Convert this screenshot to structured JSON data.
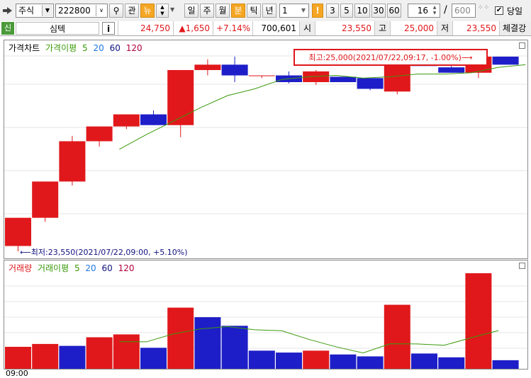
{
  "toolbar": {
    "market": "주식",
    "code": "222800",
    "btn_gwan": "관",
    "btn_new": "뉴",
    "periods": [
      "일",
      "주",
      "월",
      "분",
      "틱",
      "년"
    ],
    "selected_period": "분",
    "interval_value": "1",
    "marker": "!",
    "quick_intervals": [
      "3",
      "5",
      "10",
      "30",
      "60"
    ],
    "count_value": "16",
    "slash": "/",
    "total_value": "600",
    "today_label": "당일"
  },
  "infobar": {
    "tag": "신",
    "name": "심텍",
    "info_icon": "i",
    "price": "24,750",
    "change": "▲1,650",
    "change_pct": "+7.14%",
    "volume": "700,601",
    "open_label": "시",
    "open": "23,550",
    "high_label": "고",
    "high": "25,000",
    "low_label": "저",
    "low": "23,550",
    "trade_label": "체결강"
  },
  "price_panel": {
    "title": "가격차트",
    "ma_label": "가격이평",
    "ma_periods": [
      "5",
      "20",
      "60",
      "120"
    ],
    "high_annotation": "최고:25,000(2021/07/22,09:17, -1.00%)⟶",
    "low_annotation": "⟵최저:23,550(2021/07/22,09:00, +5.10%)"
  },
  "volume_panel": {
    "title": "거래량",
    "ma_label": "거래이평",
    "ma_periods": [
      "5",
      "20",
      "60",
      "120"
    ]
  },
  "x_axis_start": "09:00",
  "colors": {
    "up": "#e0181b",
    "down": "#1e1ec8",
    "ma5": "#3a9a0a",
    "ma20": "#1e78e0",
    "ma60": "#101080",
    "ma120": "#b0003a",
    "annot": "#e0181b"
  },
  "chart_data": [
    {
      "type": "candlestick",
      "ylim": [
        23500,
        25060
      ],
      "candles": [
        {
          "o": 23550,
          "h": 23640,
          "l": 23510,
          "c": 23760
        },
        {
          "o": 23760,
          "h": 23960,
          "l": 23730,
          "c": 24030
        },
        {
          "o": 24030,
          "h": 24370,
          "l": 24000,
          "c": 24330
        },
        {
          "o": 24330,
          "h": 24380,
          "l": 24290,
          "c": 24440
        },
        {
          "o": 24440,
          "h": 24480,
          "l": 24420,
          "c": 24530
        },
        {
          "o": 24530,
          "h": 24560,
          "l": 24490,
          "c": 24450
        },
        {
          "o": 24450,
          "h": 24860,
          "l": 24360,
          "c": 24860
        },
        {
          "o": 24860,
          "h": 24940,
          "l": 24820,
          "c": 24900
        },
        {
          "o": 24900,
          "h": 24960,
          "l": 24770,
          "c": 24820
        },
        {
          "o": 24820,
          "h": 24820,
          "l": 24800,
          "c": 24820
        },
        {
          "o": 24820,
          "h": 24850,
          "l": 24760,
          "c": 24770
        },
        {
          "o": 24770,
          "h": 24860,
          "l": 24750,
          "c": 24850
        },
        {
          "o": 24810,
          "h": 24810,
          "l": 24770,
          "c": 24770
        },
        {
          "o": 24800,
          "h": 24800,
          "l": 24710,
          "c": 24720
        },
        {
          "o": 24700,
          "h": 24940,
          "l": 24680,
          "c": 24930
        },
        {
          "o": 24930,
          "h": 24930,
          "l": 24890,
          "c": 24890
        },
        {
          "o": 24880,
          "h": 24890,
          "l": 24840,
          "c": 24840
        },
        {
          "o": 24840,
          "h": 25000,
          "l": 24800,
          "c": 24960
        },
        {
          "o": 24960,
          "h": 24960,
          "l": 24900,
          "c": 24900
        }
      ],
      "ma5": [
        null,
        null,
        null,
        null,
        24270,
        24380,
        24480,
        24580,
        24670,
        24720,
        24790,
        24810,
        24820,
        24800,
        24810,
        24830,
        24830,
        24840,
        24880,
        24900
      ]
    },
    {
      "type": "bar",
      "ylim": [
        0,
        100
      ],
      "values": [
        23,
        26,
        24,
        33,
        36,
        22,
        64,
        54,
        45,
        19,
        17,
        19,
        15,
        13,
        67,
        16,
        12,
        100,
        9
      ],
      "up": [
        true,
        true,
        false,
        true,
        true,
        false,
        true,
        false,
        false,
        false,
        false,
        true,
        false,
        false,
        true,
        false,
        false,
        true,
        false
      ],
      "ma5": [
        null,
        null,
        null,
        null,
        28.4,
        28.2,
        36.6,
        41.8,
        44.2,
        40.8,
        39.8,
        30.8,
        23,
        16.6,
        26.2,
        26,
        24.6,
        32.6,
        40
      ]
    }
  ]
}
